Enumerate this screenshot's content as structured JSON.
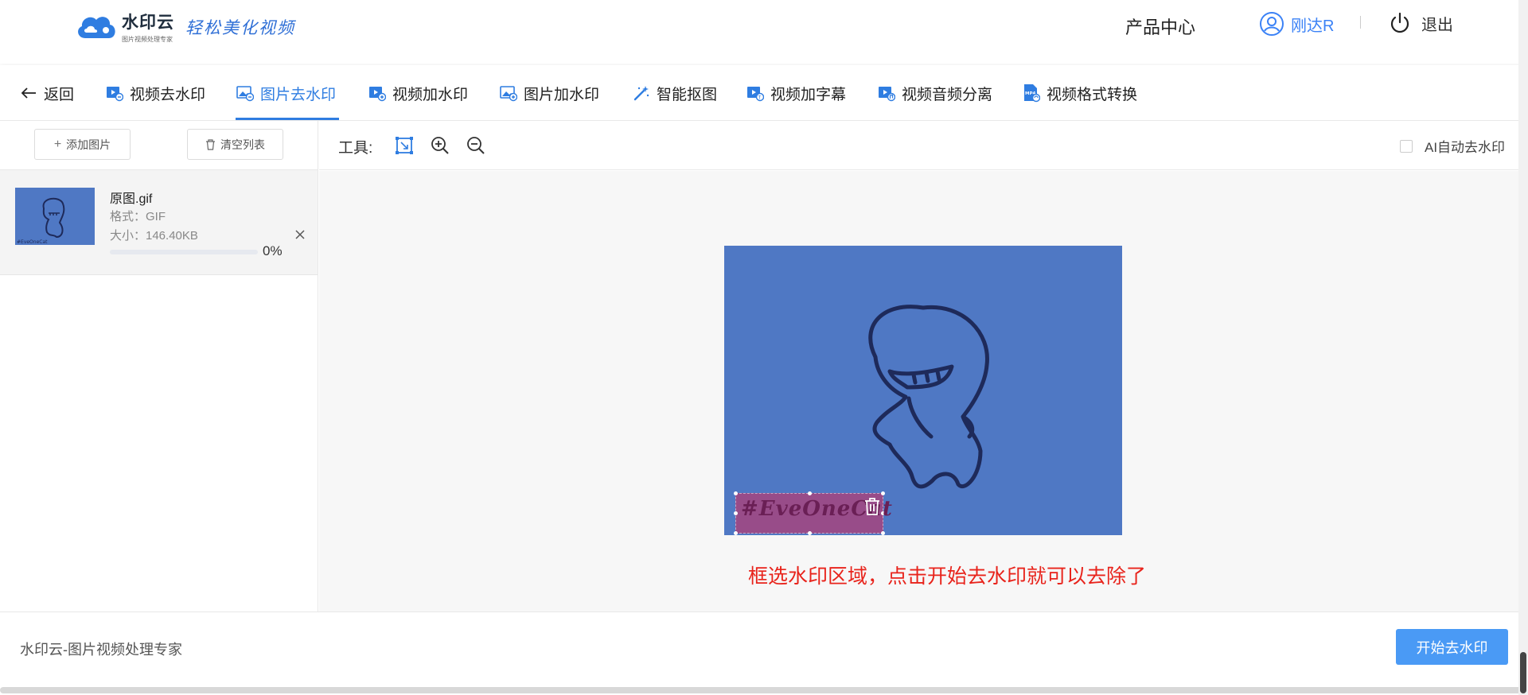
{
  "header": {
    "logo_name": "水印云",
    "logo_sub": "图片视频处理专家",
    "slogan": "轻松美化视频",
    "products": "产品中心",
    "username": "刚达R",
    "logout": "退出"
  },
  "nav": {
    "back": "返回",
    "tabs": [
      {
        "label": "视频去水印",
        "icon": "video-remove-icon"
      },
      {
        "label": "图片去水印",
        "icon": "image-remove-icon",
        "active": true
      },
      {
        "label": "视频加水印",
        "icon": "video-add-icon"
      },
      {
        "label": "图片加水印",
        "icon": "image-add-icon"
      },
      {
        "label": "智能抠图",
        "icon": "magic-wand-icon"
      },
      {
        "label": "视频加字幕",
        "icon": "subtitle-icon"
      },
      {
        "label": "视频音频分离",
        "icon": "audio-split-icon"
      },
      {
        "label": "视频格式转换",
        "icon": "mp4-convert-icon"
      }
    ]
  },
  "sidebar": {
    "add_label": "添加图片",
    "clear_label": "清空列表",
    "file": {
      "name": "原图.gif",
      "format": "格式：GIF",
      "size": "大小：146.40KB",
      "progress_pct": "0%",
      "progress": 0
    }
  },
  "tools": {
    "label": "工具:",
    "ai_auto": "AI自动去水印"
  },
  "canvas": {
    "watermark_text": "#EveOneCat",
    "hint": "框选水印区域，点击开始去水印就可以去除了"
  },
  "footer": {
    "text": "水印云-图片视频处理专家",
    "start_label": "开始去水印"
  },
  "colors": {
    "accent": "#2f7de1",
    "button": "#4a9af5",
    "hint": "#e8231b",
    "image_bg": "#4f78c4"
  }
}
